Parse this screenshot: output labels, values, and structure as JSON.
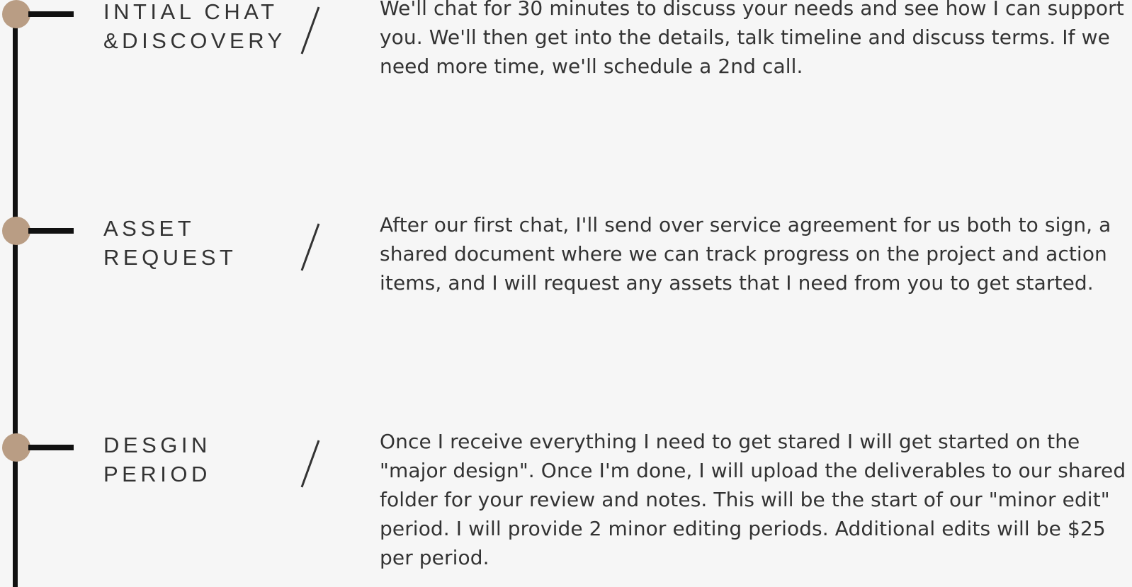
{
  "steps": [
    {
      "title": "INTIAL CHAT\n&DISCOVERY",
      "description": "We'll chat for 30 minutes to discuss your needs and see how I can support you. We'll then get into the details, talk timeline and discuss terms. If we need more time, we'll schedule a 2nd call."
    },
    {
      "title": "ASSET\nREQUEST",
      "description": "After our first chat, I'll send over service agreement for us both to sign, a shared document where we can track progress on the project and action items, and I will request any assets that I need from you to get started."
    },
    {
      "title": "DESGIN\nPERIOD",
      "description": "Once I receive everything I need to get stared I will get started on the \"major design\". Once I'm done, I will upload the deliverables to our shared folder for your review and notes. This will be the start of our \"minor edit\" period. I will provide 2 minor editing periods. Additional edits will be $25 per period."
    }
  ],
  "colors": {
    "background": "#f6f6f6",
    "line": "#111111",
    "node": "#b99d84",
    "text": "#333333"
  }
}
